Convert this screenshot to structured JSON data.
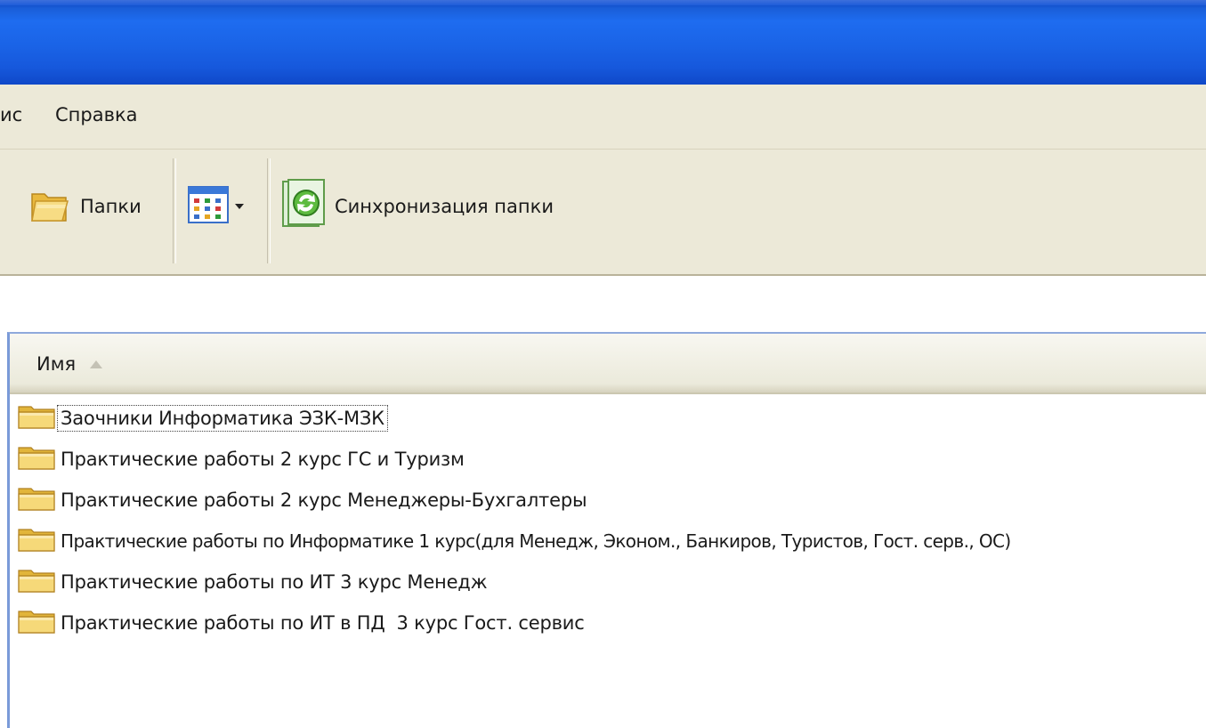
{
  "menu": {
    "tools_partial": "ис",
    "help": "Справка"
  },
  "toolbar": {
    "folders_label": "Папки",
    "views_icon": "views-grid-icon",
    "sync_label": "Синхронизация папки"
  },
  "list": {
    "column_name": "Имя",
    "sort": "ascending",
    "items": [
      {
        "label": "Заочники Информатика ЭЗК-МЗК"
      },
      {
        "label": "Практические работы 2 курс ГС и Туризм"
      },
      {
        "label": "Практические работы 2 курс Менеджеры-Бухгалтеры"
      },
      {
        "label": "Практические работы по Информатике 1 курс(для Менедж, Эконом., Банкиров, Туристов, Гост. серв., ОС)"
      },
      {
        "label": "Практические работы по ИТ 3 курс Менедж"
      },
      {
        "label": "Практические работы по ИТ в ПД  3 курс Гост. сервис"
      }
    ]
  },
  "colors": {
    "titlebar": "#1a63e6",
    "chrome": "#ece9d8",
    "folder": "#f3d36b"
  }
}
